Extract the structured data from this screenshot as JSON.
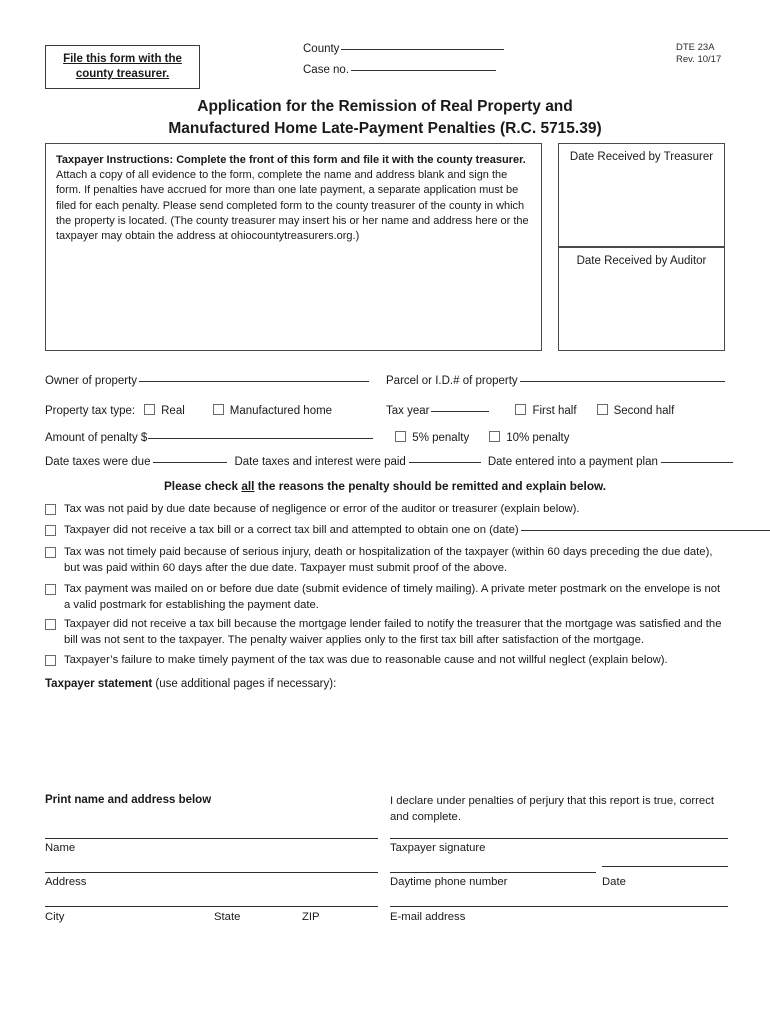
{
  "header": {
    "file_box_line1": "File this form with the",
    "file_box_line2": "county treasurer.",
    "county_label": "County",
    "case_no_label": "Case no.",
    "form_number": "DTE 23A",
    "revision": "Rev. 10/17"
  },
  "title": {
    "line1": "Application for the Remission of Real Property and",
    "line2": "Manufactured Home Late-Payment Penalties (R.C. 5715.39)"
  },
  "instructions": {
    "bold_lead": "Taxpayer Instructions: Complete the front of this form and file it with the county treasurer.",
    "body": " Attach a copy of all evidence to the form, complete the name and address blank and sign the form. If penalties have accrued for more than one late payment, a separate application must be filed for each penalty. Please send completed form to the county treasurer of the county in which the property is located. (The county treasurer may insert his or her name and address here or the taxpayer may obtain the address at ohiocountytreasurers.org.)"
  },
  "received": {
    "treasurer": "Date Received by Treasurer",
    "auditor": "Date Received by Auditor"
  },
  "fields": {
    "owner_of_property": "Owner of property",
    "parcel_id": "Parcel or I.D.# of property",
    "property_tax_type": "Property tax type:",
    "real": "Real",
    "manufactured_home": "Manufactured home",
    "tax_year": "Tax year",
    "first_half": "First half",
    "second_half": "Second half",
    "amount_of_penalty": "Amount of penalty $",
    "penalty_5": "5% penalty",
    "penalty_10": "10% penalty",
    "date_taxes_due": "Date taxes were due",
    "date_taxes_paid": "Date taxes and interest were paid",
    "date_payment_plan": "Date entered into a payment plan"
  },
  "check_note": {
    "before": "Please check ",
    "emphasis": "all",
    "after": " the reasons the penalty should be remitted and explain below."
  },
  "reasons": [
    {
      "text": "Tax was not paid by due date because of negligence or error of the auditor or treasurer (explain below).",
      "has_trailing_line": false
    },
    {
      "text": "Taxpayer did not receive a tax bill or a correct tax bill and attempted to obtain one on (date)",
      "has_trailing_line": true
    },
    {
      "text": "Tax was not timely paid because of serious injury, death or hospitalization of the taxpayer (within 60 days preceding the due date), but was paid within 60 days after the due date. Taxpayer must submit proof of the above.",
      "has_trailing_line": false
    },
    {
      "text": "Tax payment was mailed on or before due date (submit evidence of timely mailing). A private meter postmark on the envelope is not a valid postmark for establishing the payment date.",
      "has_trailing_line": false
    },
    {
      "text": "Taxpayer did not receive a tax bill because the mortgage lender failed to notify the treasurer that the mortgage was satisfied and the bill was not sent to the taxpayer. The penalty waiver applies only to the first tax bill after satisfaction of the mortgage.",
      "has_trailing_line": false
    },
    {
      "text": "Taxpayer’s failure to make timely payment of the tax was due to reasonable cause and not willful neglect (explain below).",
      "has_trailing_line": false
    }
  ],
  "statement": {
    "bold": "Taxpayer statement",
    "rest": " (use additional pages if necessary):"
  },
  "signature": {
    "print_heading": "Print name and address below",
    "declaration": "I declare under penalties of perjury that this report is true, correct and complete.",
    "name": "Name",
    "address": "Address",
    "city": "City",
    "state": "State",
    "zip": "ZIP",
    "taxpayer_signature": "Taxpayer signature",
    "daytime_phone": "Daytime phone number",
    "date": "Date",
    "email": "E-mail address"
  }
}
